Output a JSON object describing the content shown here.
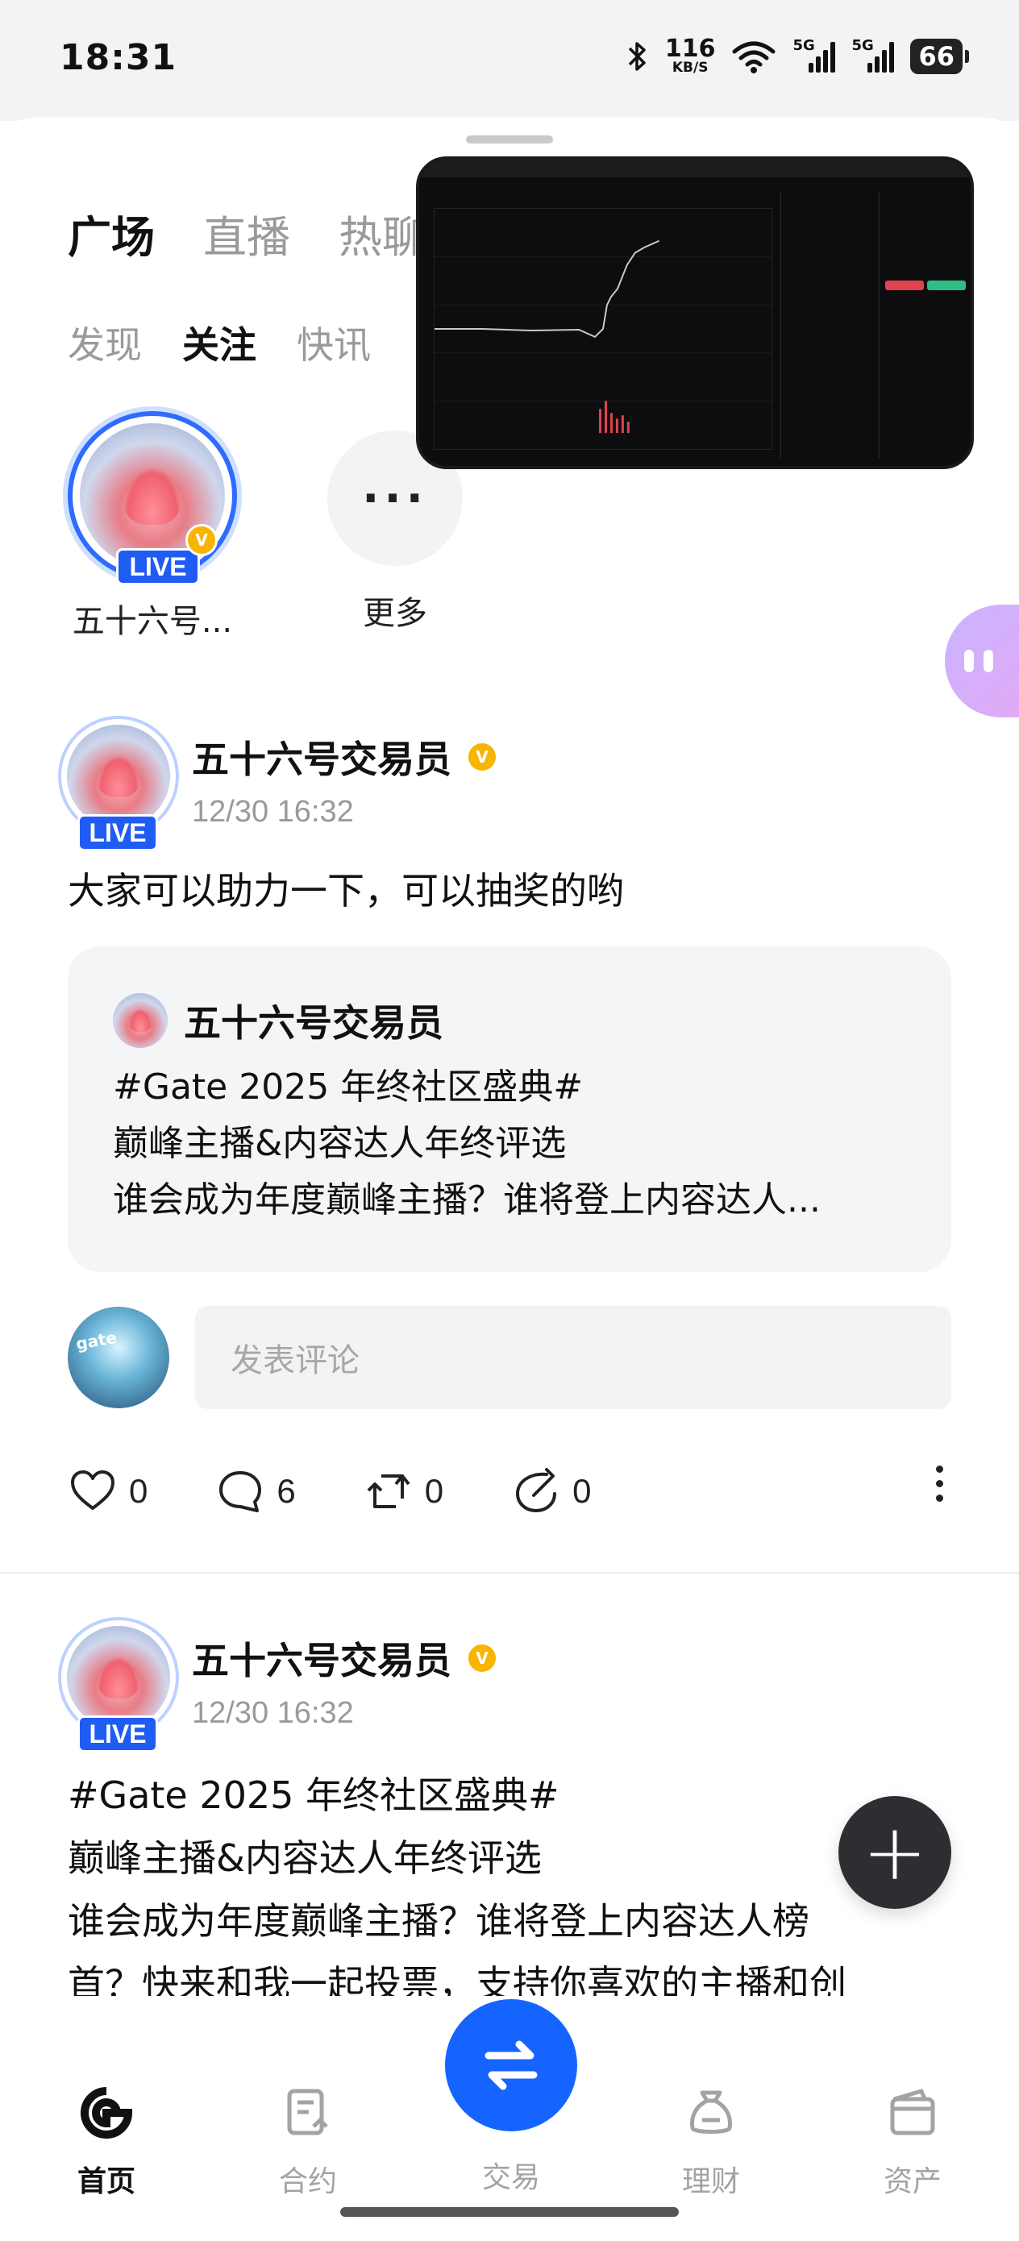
{
  "status_bar": {
    "time": "18:31",
    "net_speed_value": "116",
    "net_speed_unit": "KB/S",
    "signal1_label": "5G",
    "signal2_label": "5G",
    "battery": "66"
  },
  "top_tabs": [
    {
      "label": "广场",
      "active": true
    },
    {
      "label": "直播",
      "active": false
    },
    {
      "label": "热聊",
      "active": false
    }
  ],
  "sub_tabs": [
    {
      "label": "发现",
      "active": false
    },
    {
      "label": "关注",
      "active": true
    },
    {
      "label": "快讯",
      "active": false
    }
  ],
  "stories": {
    "item1_label": "五十六号...",
    "live_label": "LIVE",
    "verified_mark": "V",
    "more_label": "更多",
    "more_dots": "···"
  },
  "posts": [
    {
      "author": "五十六号交易员",
      "time": "12/30 16:32",
      "live": "LIVE",
      "text": "大家可以助力一下，可以抽奖的哟",
      "quote": {
        "author": "五十六号交易员",
        "lines": [
          "#Gate 2025 年终社区盛典#",
          "巅峰主播&内容达人年终评选",
          "谁会成为年度巅峰主播？谁将登上内容达人..."
        ]
      },
      "comment_placeholder": "发表评论",
      "likes": "0",
      "comments": "6",
      "reposts": "0",
      "shares": "0"
    },
    {
      "author": "五十六号交易员",
      "time": "12/30 16:32",
      "live": "LIVE",
      "lines": [
        "#Gate 2025 年终社区盛典#",
        "巅峰主播&内容达人年终评选",
        "谁会成为年度巅峰主播？谁将登上内容达人榜",
        "首？快来和我一起投票，支持你喜欢的主播和创"
      ]
    }
  ],
  "fab_label": "+",
  "bottom_nav": [
    {
      "label": "首页",
      "icon": "home-icon",
      "active": true
    },
    {
      "label": "合约",
      "icon": "contract-icon",
      "active": false
    },
    {
      "label": "交易",
      "icon": "trade-swap-icon",
      "active": false
    },
    {
      "label": "理财",
      "icon": "wealth-bag-icon",
      "active": false
    },
    {
      "label": "资产",
      "icon": "wallet-icon",
      "active": false
    }
  ],
  "colors": {
    "brand_blue": "#1664ff",
    "live_blue": "#1f5cf3",
    "verified_gold": "#f7b500",
    "muted_text": "#9a9a9a"
  }
}
